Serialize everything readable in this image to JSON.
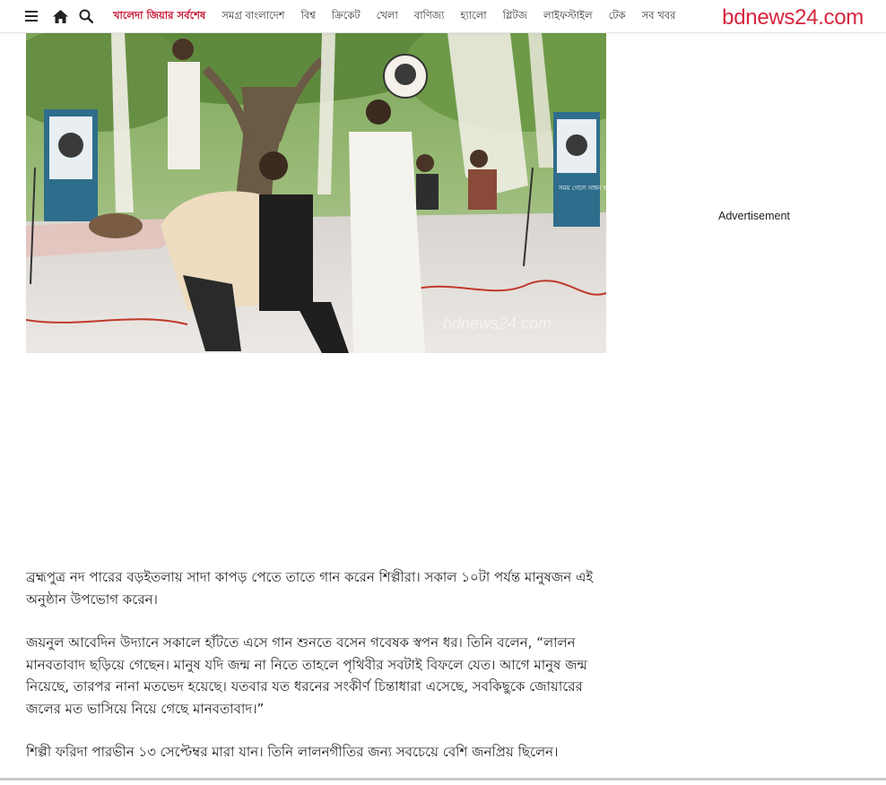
{
  "header": {
    "logo": "bdnews24.com",
    "nav_links": [
      "খালেদা জিয়ার সর্বশেষ",
      "সমগ্র বাংলাদেশ",
      "বিশ্ব",
      "ক্রিকেট",
      "খেলা",
      "বাণিজ্য",
      "হ্যালো",
      "গ্লিটজ",
      "লাইফস্টাইল",
      "টেক",
      "সব খবর"
    ],
    "icons": [
      "menu-icon",
      "home-icon",
      "search-icon"
    ]
  },
  "photo": {
    "watermark": "bdnews24.com",
    "banner_text": "সময় গেলে সাধন হবে না"
  },
  "sidebar": {
    "ad_label": "Advertisement"
  },
  "article": {
    "paragraphs": [
      "ব্রহ্মপুত্র নদ পারের বড়ইতলায় সাদা কাপড় পেতে তাতে গান করেন শিল্পীরা। সকাল ১০টা পর্যন্ত মানুষজন এই অনুষ্ঠান উপভোগ করেন।",
      "জয়নুল আবেদিন উদ্যানে সকালে হাঁটতে এসে গান শুনতে বসেন গবেষক স্বপন ধর। তিনি বলেন, “লালন মানবতাবাদ ছড়িয়ে গেছেন। মানুষ যদি জন্ম না নিতে তাহলে পৃথিবীর সবটাই বিফলে যেত। আগে মানুষ জন্ম নিয়েছে, তারপর নানা মতভেদ হয়েছে। যতবার যত ধরনের সংকীর্ণ চিন্তাধারা এসেছে, সবকিছুকে জোয়ারের জলের মত ভাসিয়ে নিয়ে গেছে মানবতাবাদ।”",
      "শিল্পী ফরিদা পারভীন ১৩ সেপ্টেম্বর মারা যান। তিনি লালনগীতির জন্য সবচেয়ে বেশি জনপ্রিয় ছিলেন।"
    ]
  },
  "colors": {
    "brand_red": "#d7263d",
    "highlight_link": "#c8102e"
  }
}
